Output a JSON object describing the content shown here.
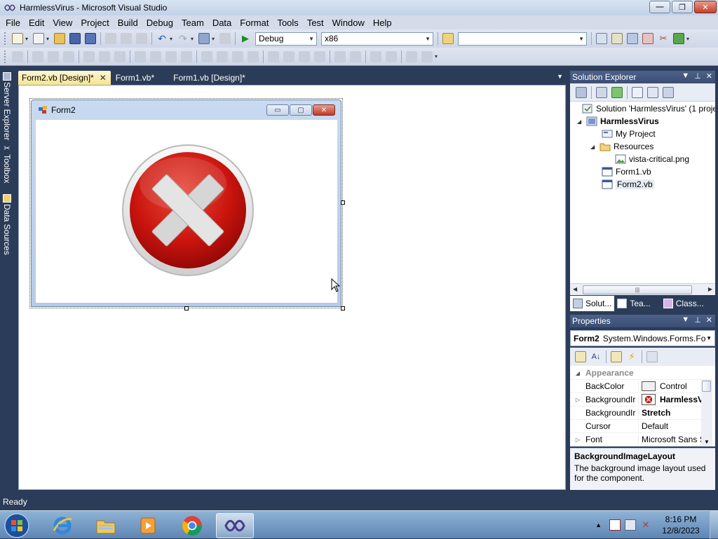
{
  "window": {
    "title": "HarmlessVirus - Microsoft Visual Studio"
  },
  "menu": [
    "File",
    "Edit",
    "View",
    "Project",
    "Build",
    "Debug",
    "Team",
    "Data",
    "Format",
    "Tools",
    "Test",
    "Window",
    "Help"
  ],
  "toolbar": {
    "configuration": "Debug",
    "platform": "x86",
    "find": ""
  },
  "side_tabs": [
    "Server Explorer",
    "Toolbox",
    "Data Sources"
  ],
  "doc_tabs": [
    "Form2.vb [Design]*",
    "Form1.vb*",
    "Form1.vb [Design]*"
  ],
  "designer_form": {
    "title": "Form2"
  },
  "solution_explorer": {
    "title": "Solution Explorer",
    "items": {
      "solution": "Solution 'HarmlessVirus' (1 proje",
      "project": "HarmlessVirus",
      "my_project": "My Project",
      "resources": "Resources",
      "image": "vista-critical.png",
      "form1": "Form1.vb",
      "form2": "Form2.vb"
    },
    "tabs": [
      "Solut...",
      "Tea...",
      "Class..."
    ]
  },
  "properties": {
    "title": "Properties",
    "object": "Form2",
    "object_type": "System.Windows.Forms.Fo",
    "category": "Appearance",
    "rows": [
      {
        "name": "BackColor",
        "value": "Control"
      },
      {
        "name": "BackgroundIr",
        "value": "HarmlessV"
      },
      {
        "name": "BackgroundIr",
        "value": "Stretch"
      },
      {
        "name": "Cursor",
        "value": "Default"
      },
      {
        "name": "Font",
        "value": "Microsoft Sans S"
      }
    ],
    "desc_title": "BackgroundImageLayout",
    "desc_text": "The background image layout used for the component."
  },
  "status": "Ready",
  "clock": {
    "time": "8:16 PM",
    "date": "12/8/2023"
  }
}
